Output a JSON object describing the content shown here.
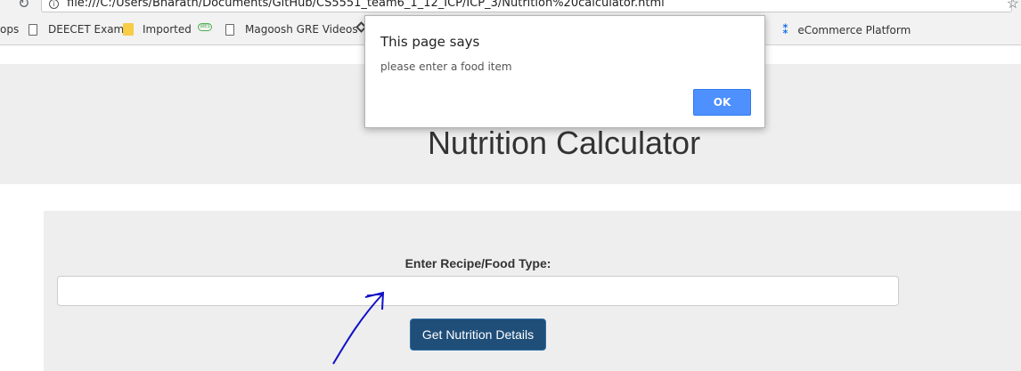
{
  "browser": {
    "url": "file:///C:/Users/Bharath/Documents/GitHub/CS5551_team6_1_12_ICP/ICP_3/Nutrition%20calculator.html",
    "bookmarks": [
      {
        "label": "ops",
        "icon": "apps-icon"
      },
      {
        "label": "DEECET Exam",
        "icon": "page-icon"
      },
      {
        "label": "Imported",
        "icon": "folder-icon"
      },
      {
        "label": "",
        "icon": "site-badge-icon"
      },
      {
        "label": "Magoosh GRE Videos",
        "icon": "page-icon"
      },
      {
        "label": "eCommerce Platform",
        "icon": "ecommerce-icon"
      }
    ]
  },
  "page": {
    "title": "Nutrition Calculator",
    "form": {
      "label": "Enter Recipe/Food Type:",
      "input_value": "",
      "button_label": "Get Nutrition Details"
    }
  },
  "alert": {
    "title": "This page says",
    "message": "please enter a food item",
    "ok_label": "OK"
  },
  "colors": {
    "button_bg": "#1f4e79",
    "alert_ok_bg": "#4d90fe",
    "panel_bg": "#eeeeee",
    "annotation_arrow": "#1010c8"
  }
}
